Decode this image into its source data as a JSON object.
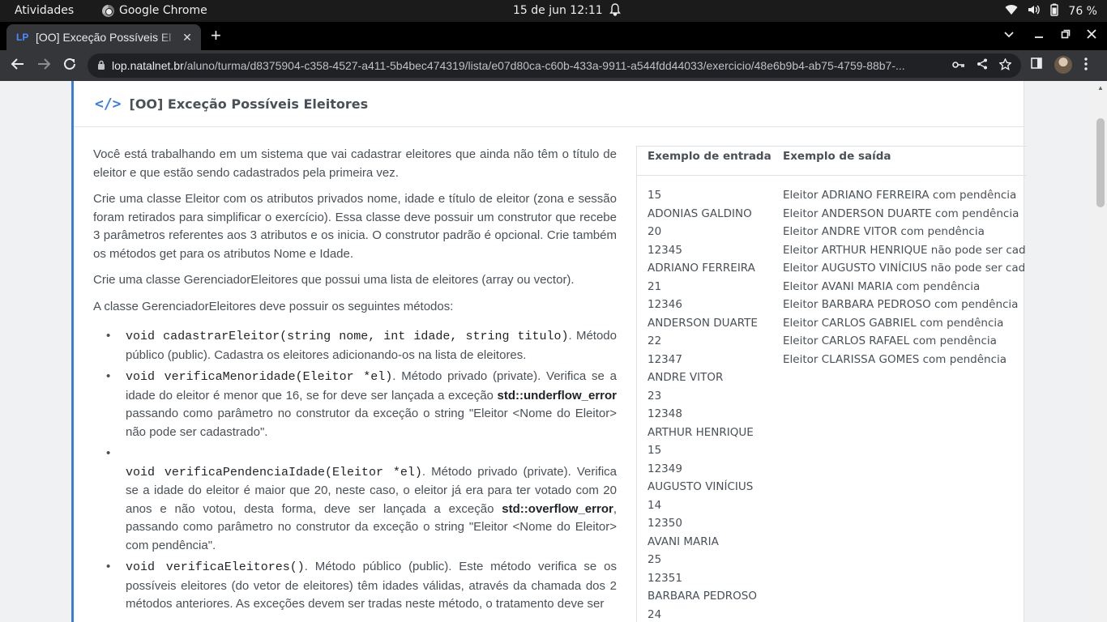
{
  "system_bar": {
    "activities": "Atividades",
    "app_name": "Google Chrome",
    "date_time": "15 de jun  12:11",
    "battery": "76 %"
  },
  "browser": {
    "tab_title": "[OO] Exceção Possíveis El",
    "url_host": "lop.natalnet.br",
    "url_path": "/aluno/turma/d8375904-c358-4527-a411-5b4bec474319/lista/e07d80ca-c60b-433a-9911-a544fdd44033/exercicio/48e6b9b4-ab75-4759-88b7-..."
  },
  "page": {
    "title": "[OO] Exceção Possíveis Eleitores",
    "intro": "Você está trabalhando em um sistema que vai cadastrar eleitores que ainda não têm o título de eleitor e que estão sendo cadastrados pela primeira vez.",
    "p2": "Crie uma classe Eleitor com os atributos privados nome, idade e título de eleitor (zona e sessão foram retirados para simplificar o exercício). Essa classe deve possuir um construtor que recebe 3 parâmetros referentes aos 3 atributos e os inicia. O construtor padrão é opcional. Crie também os métodos get para os atributos Nome e Idade.",
    "p3": "Crie uma classe GerenciadorEleitores que possui uma lista de eleitores (array ou vector).",
    "p4": "A classe GerenciadorEleitores deve possuir os seguintes métodos:",
    "m1_code": "void cadastrarEleitor(string nome, int idade, string titulo)",
    "m1_text": ". Método público (public). Cadastra os eleitores adicionando-os na lista de eleitores.",
    "m2_code": "void verificaMenoridade(Eleitor *el)",
    "m2_text_a": ". Método privado (private). Verifica se a idade do eleitor é menor que 16, se for deve ser lançada a exceção ",
    "m2_bold": "std::underflow_error",
    "m2_text_b": " passando como parâmetro no construtor da exceção o string \"Eleitor <Nome do Eleitor> não pode ser cadastrado\".",
    "m3_code": "void verificaPendenciaIdade(Eleitor *el)",
    "m3_text_a": ". Método privado (private). Verifica se a idade do eleitor é maior que 20, neste caso, o eleitor já era para ter votado com 20 anos e não votou, desta forma, deve ser lançada a exceção ",
    "m3_bold": "std::overflow_error",
    "m3_text_b": ",  passando como parâmetro no construtor da exceção o string \"Eleitor <Nome do Eleitor> com pendência\".",
    "m4_code": "void verificaEleitores()",
    "m4_text": ". Método público (public). Este método verifica se os possíveis eleitores (do vetor de eleitores) têm idades válidas, através da chamada dos 2 métodos anteriores. As exceções devem ser tradas neste método, o tratamento deve ser"
  },
  "samples": {
    "input_header": "Exemplo de entrada",
    "output_header": "Exemplo de saída",
    "input_lines": [
      "15",
      "ADONIAS GALDINO",
      "20",
      "12345",
      "ADRIANO FERREIRA",
      "21",
      "12346",
      "ANDERSON DUARTE",
      "22",
      "12347",
      "ANDRE VITOR",
      "23",
      "12348",
      "ARTHUR HENRIQUE",
      "15",
      "12349",
      "AUGUSTO VINÍCIUS",
      "14",
      "12350",
      "AVANI MARIA",
      "25",
      "12351",
      "BARBARA PEDROSO",
      "24"
    ],
    "output_lines": [
      "Eleitor ADRIANO FERREIRA com pendência",
      "Eleitor ANDERSON DUARTE com pendência",
      "Eleitor ANDRE VITOR com pendência",
      "Eleitor ARTHUR HENRIQUE não pode ser cadastrado",
      "Eleitor AUGUSTO VINÍCIUS não pode ser cadastrado",
      "Eleitor AVANI MARIA com pendência",
      "Eleitor BARBARA PEDROSO com pendência",
      "Eleitor CARLOS GABRIEL com pendência",
      "Eleitor CARLOS RAFAEL com pendência",
      "Eleitor CLARISSA GOMES com pendência"
    ]
  }
}
